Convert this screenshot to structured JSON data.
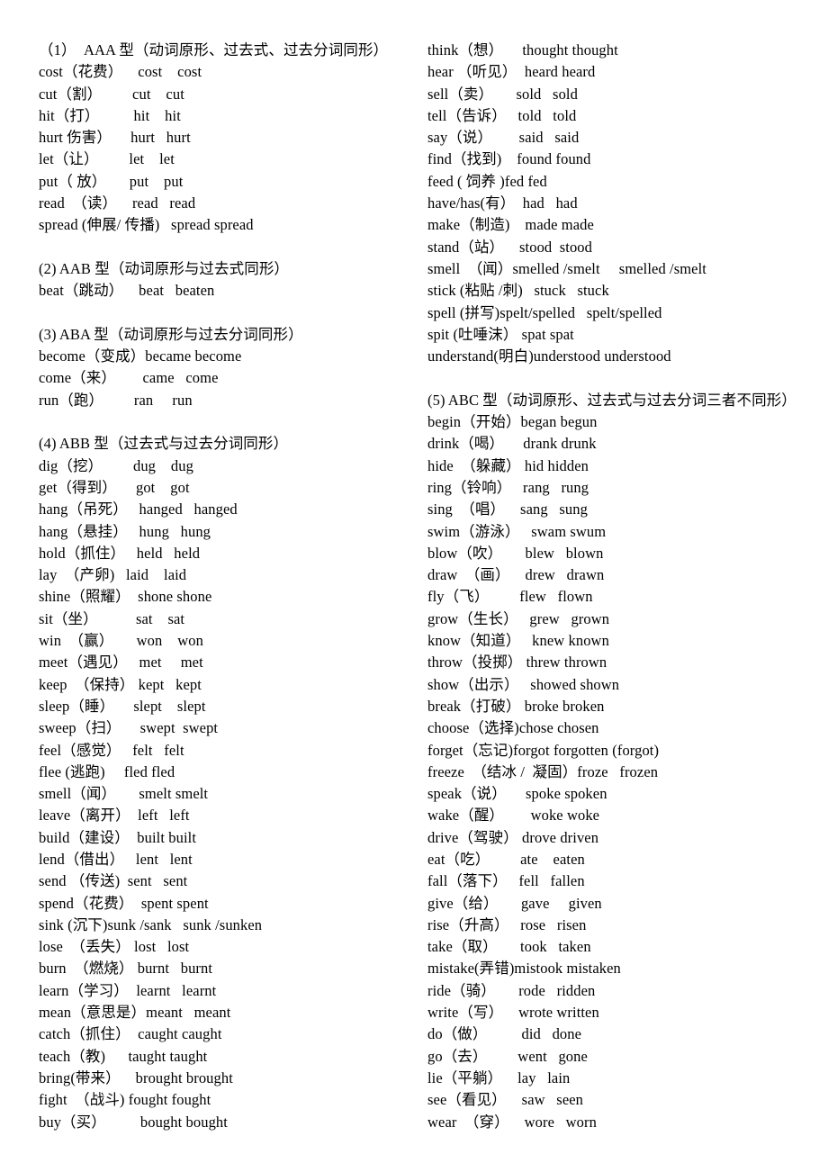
{
  "document": {
    "title": "不规则动词表",
    "background_color": "#ffffff",
    "text_color": "#000000"
  },
  "left_column": {
    "blocks": [
      {
        "type": "heading",
        "text": "（1）  AAA 型（动词原形、过去式、过去分词同形）"
      },
      {
        "type": "line",
        "text": "cost（花费）    cost    cost"
      },
      {
        "type": "line",
        "text": "cut（割）        cut    cut"
      },
      {
        "type": "line",
        "text": "hit（打）         hit    hit"
      },
      {
        "type": "line",
        "text": "hurt 伤害）     hurt   hurt"
      },
      {
        "type": "line",
        "text": "let（让）        let    let"
      },
      {
        "type": "line",
        "text": "put（ 放）      put    put"
      },
      {
        "type": "line",
        "text": "read  （读）    read   read"
      },
      {
        "type": "line",
        "text": "spread (伸展/ 传播)   spread spread"
      },
      {
        "type": "spacer"
      },
      {
        "type": "heading",
        "text": "(2) AAB 型（动词原形与过去式同形）"
      },
      {
        "type": "line",
        "text": "beat（跳动）    beat   beaten"
      },
      {
        "type": "spacer"
      },
      {
        "type": "heading",
        "text": "(3) ABA 型（动词原形与过去分词同形）"
      },
      {
        "type": "line",
        "text": "become（变成）became become"
      },
      {
        "type": "line",
        "text": "come（来）       came   come"
      },
      {
        "type": "line",
        "text": "run（跑）        ran     run"
      },
      {
        "type": "spacer"
      },
      {
        "type": "heading",
        "text": "(4) ABB 型（过去式与过去分词同形）"
      },
      {
        "type": "line",
        "text": "dig（挖）        dug    dug"
      },
      {
        "type": "line",
        "text": "get（得到）     got    got"
      },
      {
        "type": "line",
        "text": "hang（吊死）   hanged   hanged"
      },
      {
        "type": "line",
        "text": "hang（悬挂）   hung   hung"
      },
      {
        "type": "line",
        "text": "hold（抓住）   held   held"
      },
      {
        "type": "line",
        "text": "lay  （产卵)   laid    laid"
      },
      {
        "type": "line",
        "text": "shine（照耀）  shone shone"
      },
      {
        "type": "line",
        "text": "sit（坐）          sat    sat"
      },
      {
        "type": "line",
        "text": "win  （赢）      won    won"
      },
      {
        "type": "line",
        "text": "meet（遇见）   met     met"
      },
      {
        "type": "line",
        "text": "keep  （保持） kept   kept"
      },
      {
        "type": "line",
        "text": "sleep（睡）     slept    slept"
      },
      {
        "type": "line",
        "text": "sweep（扫）     swept  swept"
      },
      {
        "type": "line",
        "text": "feel（感觉）   felt   felt"
      },
      {
        "type": "line",
        "text": "flee (逃跑)     fled fled"
      },
      {
        "type": "line",
        "text": "smell（闻）      smelt smelt"
      },
      {
        "type": "line",
        "text": "leave（离开）  left   left"
      },
      {
        "type": "line",
        "text": "build（建设）  built built"
      },
      {
        "type": "line",
        "text": "lend（借出）   lent   lent"
      },
      {
        "type": "line",
        "text": "send （传送)  sent   sent"
      },
      {
        "type": "line",
        "text": "spend（花费）  spent spent"
      },
      {
        "type": "line",
        "text": "sink (沉下)sunk /sank   sunk /sunken"
      },
      {
        "type": "line",
        "text": "lose  （丢失） lost   lost"
      },
      {
        "type": "line",
        "text": "burn  （燃烧） burnt   burnt"
      },
      {
        "type": "line",
        "text": "learn（学习）  learnt   learnt"
      },
      {
        "type": "line",
        "text": "mean（意思是）meant   meant"
      },
      {
        "type": "line",
        "text": "catch（抓住）  caught caught"
      },
      {
        "type": "line",
        "text": "teach（教)      taught taught"
      },
      {
        "type": "line",
        "text": "bring(带来）    brought brought"
      },
      {
        "type": "line",
        "text": "fight  （战斗) fought fought"
      },
      {
        "type": "line",
        "text": "buy（买）         bought bought"
      }
    ]
  },
  "right_column": {
    "blocks": [
      {
        "type": "line",
        "text": "think（想）     thought thought"
      },
      {
        "type": "line",
        "text": "hear （听见）  heard heard"
      },
      {
        "type": "line",
        "text": "sell（卖）      sold   sold"
      },
      {
        "type": "line",
        "text": "tell（告诉）   told   told"
      },
      {
        "type": "line",
        "text": "say（说）       said   said"
      },
      {
        "type": "line",
        "text": "find（找到)    found found"
      },
      {
        "type": "line",
        "text": "feed ( 饲养 )fed fed"
      },
      {
        "type": "line",
        "text": "have/has(有）  had   had"
      },
      {
        "type": "line",
        "text": "make（制造)    made made"
      },
      {
        "type": "line",
        "text": "stand（站）    stood  stood"
      },
      {
        "type": "line",
        "text": "smell  （闻）smelled /smelt     smelled /smelt"
      },
      {
        "type": "line",
        "text": "stick (粘贴 /刺)   stuck   stuck"
      },
      {
        "type": "line",
        "text": "spell (拼写)spelt/spelled   spelt/spelled"
      },
      {
        "type": "line",
        "text": "spit (吐唾沫） spat spat"
      },
      {
        "type": "line",
        "text": "understand(明白)understood understood"
      },
      {
        "type": "spacer"
      },
      {
        "type": "heading",
        "text": "(5) ABC 型（动词原形、过去式与过去分词三者不同形）"
      },
      {
        "type": "line",
        "text": "begin（开始）began begun"
      },
      {
        "type": "line",
        "text": "drink（喝）     drank drunk"
      },
      {
        "type": "line",
        "text": "hide  （躲藏） hid hidden"
      },
      {
        "type": "line",
        "text": "ring（铃响）   rang   rung"
      },
      {
        "type": "line",
        "text": "sing  （唱）    sang   sung"
      },
      {
        "type": "line",
        "text": "swim（游泳）   swam swum"
      },
      {
        "type": "line",
        "text": "blow（吹）      blew   blown"
      },
      {
        "type": "line",
        "text": "draw  （画）    drew   drawn"
      },
      {
        "type": "line",
        "text": "fly（飞）        flew   flown"
      },
      {
        "type": "line",
        "text": "grow（生长）   grew   grown"
      },
      {
        "type": "line",
        "text": "know（知道）   knew known"
      },
      {
        "type": "line",
        "text": "throw（投掷） threw thrown"
      },
      {
        "type": "line",
        "text": "show（出示）   showed shown"
      },
      {
        "type": "line",
        "text": "break（打破） broke broken"
      },
      {
        "type": "line",
        "text": "choose（选择)chose chosen"
      },
      {
        "type": "line",
        "text": "forget（忘记)forgot forgotten (forgot)"
      },
      {
        "type": "line",
        "text": "freeze  （结冰 /  凝固）froze   frozen"
      },
      {
        "type": "line",
        "text": "speak（说）     spoke spoken"
      },
      {
        "type": "line",
        "text": "wake（醒）       woke woke"
      },
      {
        "type": "line",
        "text": "drive（驾驶） drove driven"
      },
      {
        "type": "line",
        "text": "eat（吃）        ate    eaten"
      },
      {
        "type": "line",
        "text": "fall（落下）   fell   fallen"
      },
      {
        "type": "line",
        "text": "give（给）      gave     given"
      },
      {
        "type": "line",
        "text": "rise（升高）   rose   risen"
      },
      {
        "type": "line",
        "text": "take（取）      took   taken"
      },
      {
        "type": "line",
        "text": "mistake(弄错)mistook mistaken"
      },
      {
        "type": "line",
        "text": "ride（骑）      rode   ridden"
      },
      {
        "type": "line",
        "text": "write（写）    wrote written"
      },
      {
        "type": "line",
        "text": "do（做）         did   done"
      },
      {
        "type": "line",
        "text": "go（去）        went   gone"
      },
      {
        "type": "line",
        "text": "lie（平躺）    lay   lain"
      },
      {
        "type": "line",
        "text": "see（看见）    saw   seen"
      },
      {
        "type": "line",
        "text": "wear  （穿）    wore   worn"
      }
    ]
  }
}
